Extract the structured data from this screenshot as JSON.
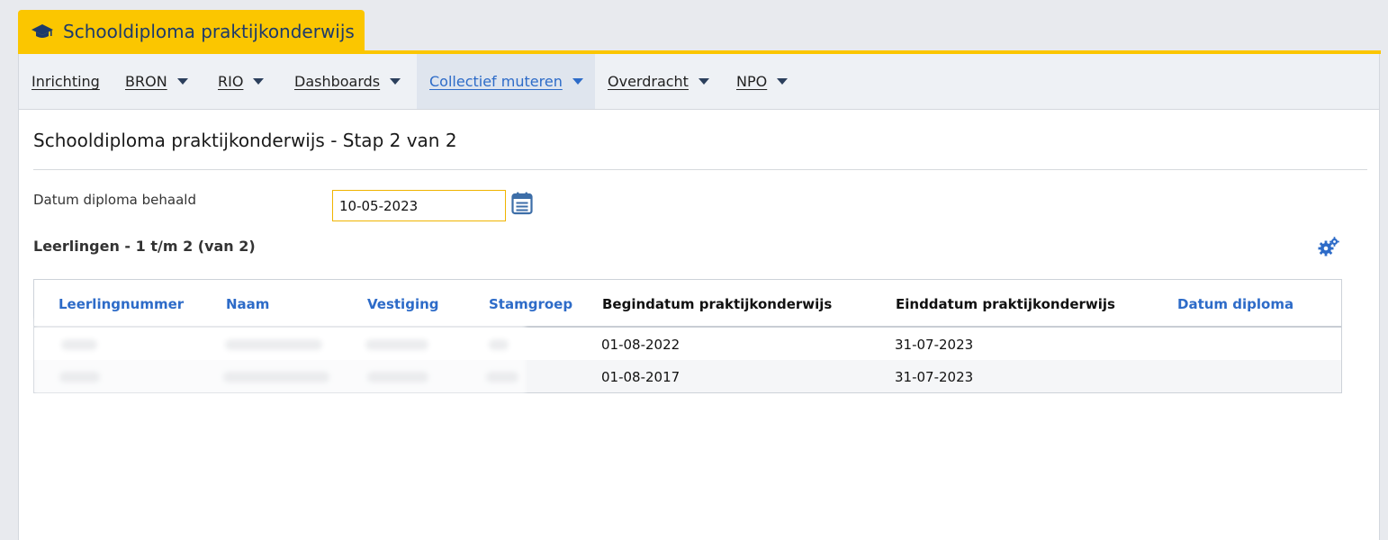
{
  "tab": {
    "title": "Schooldiploma praktijkonderwijs",
    "icon": "graduation-cap-icon"
  },
  "nav": {
    "items": [
      {
        "label": "Inrichting",
        "dropdown": false,
        "active": false
      },
      {
        "label": "BRON",
        "dropdown": true,
        "active": false
      },
      {
        "label": "RIO",
        "dropdown": true,
        "active": false
      },
      {
        "label": "Dashboards",
        "dropdown": true,
        "active": false
      },
      {
        "label": "Collectief muteren",
        "dropdown": true,
        "active": true
      },
      {
        "label": "Overdracht",
        "dropdown": true,
        "active": false
      },
      {
        "label": "NPO",
        "dropdown": true,
        "active": false
      }
    ]
  },
  "page": {
    "title": "Schooldiploma praktijkonderwijs - Stap 2 van 2",
    "date_label": "Datum diploma behaald",
    "date_value": "10-05-2023",
    "section_title": "Leerlingen - 1 t/m 2 (van 2)"
  },
  "table": {
    "columns": [
      "Leerlingnummer",
      "Naam",
      "Vestiging",
      "Stamgroep",
      "Begindatum praktijkonderwijs",
      "Einddatum praktijkonderwijs",
      "Datum diploma"
    ],
    "rows": [
      {
        "begindatum": "01-08-2022",
        "einddatum": "31-07-2023",
        "datum_diploma": ""
      },
      {
        "begindatum": "01-08-2017",
        "einddatum": "31-07-2023",
        "datum_diploma": ""
      }
    ]
  },
  "colors": {
    "accent": "#fbc600",
    "link": "#2d6bc8",
    "nav_bg": "#eef1f5"
  }
}
